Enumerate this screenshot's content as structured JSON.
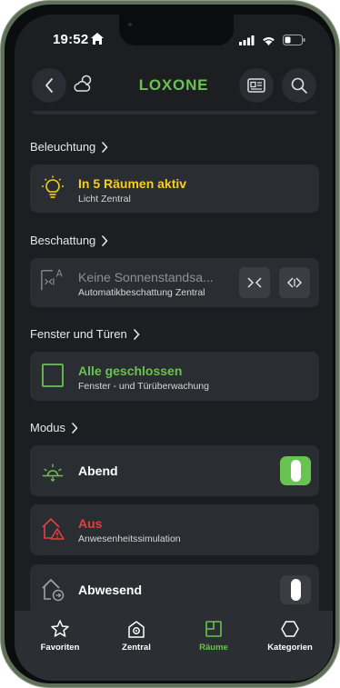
{
  "status": {
    "time": "19:52"
  },
  "header": {
    "brand": "LOXONE"
  },
  "sections": [
    {
      "title": "Beleuchtung",
      "card": {
        "title": "In 5 Räumen aktiv",
        "subtitle": "Licht Zentral",
        "state_color": "#f5d020"
      }
    },
    {
      "title": "Beschattung",
      "card": {
        "title": "Keine Sonnenstandsa...",
        "subtitle": "Automatikbeschattung Zentral",
        "state_color": "#7f8287"
      }
    },
    {
      "title": "Fenster und Türen",
      "card": {
        "title": "Alle geschlossen",
        "subtitle": "Fenster - und Türüberwachung",
        "state_color": "#69c350"
      }
    },
    {
      "title": "Modus",
      "cards": [
        {
          "title": "Abend",
          "subtitle": "",
          "toggle_on": true
        },
        {
          "title": "Aus",
          "subtitle": "Anwesenheitssimulation",
          "state_color": "#e2403f"
        },
        {
          "title": "Abwesend",
          "subtitle": "",
          "toggle_on": false
        }
      ]
    }
  ],
  "tabs": [
    {
      "label": "Favoriten",
      "icon": "star-icon",
      "active": false
    },
    {
      "label": "Zentral",
      "icon": "house-icon",
      "active": false
    },
    {
      "label": "Räume",
      "icon": "room-icon",
      "active": true
    },
    {
      "label": "Kategorien",
      "icon": "hexagon-icon",
      "active": false
    }
  ],
  "colors": {
    "accent": "#69c350",
    "background": "#1c1e21",
    "card": "#2a2d31",
    "warning": "#e2403f",
    "light": "#f5d020"
  }
}
